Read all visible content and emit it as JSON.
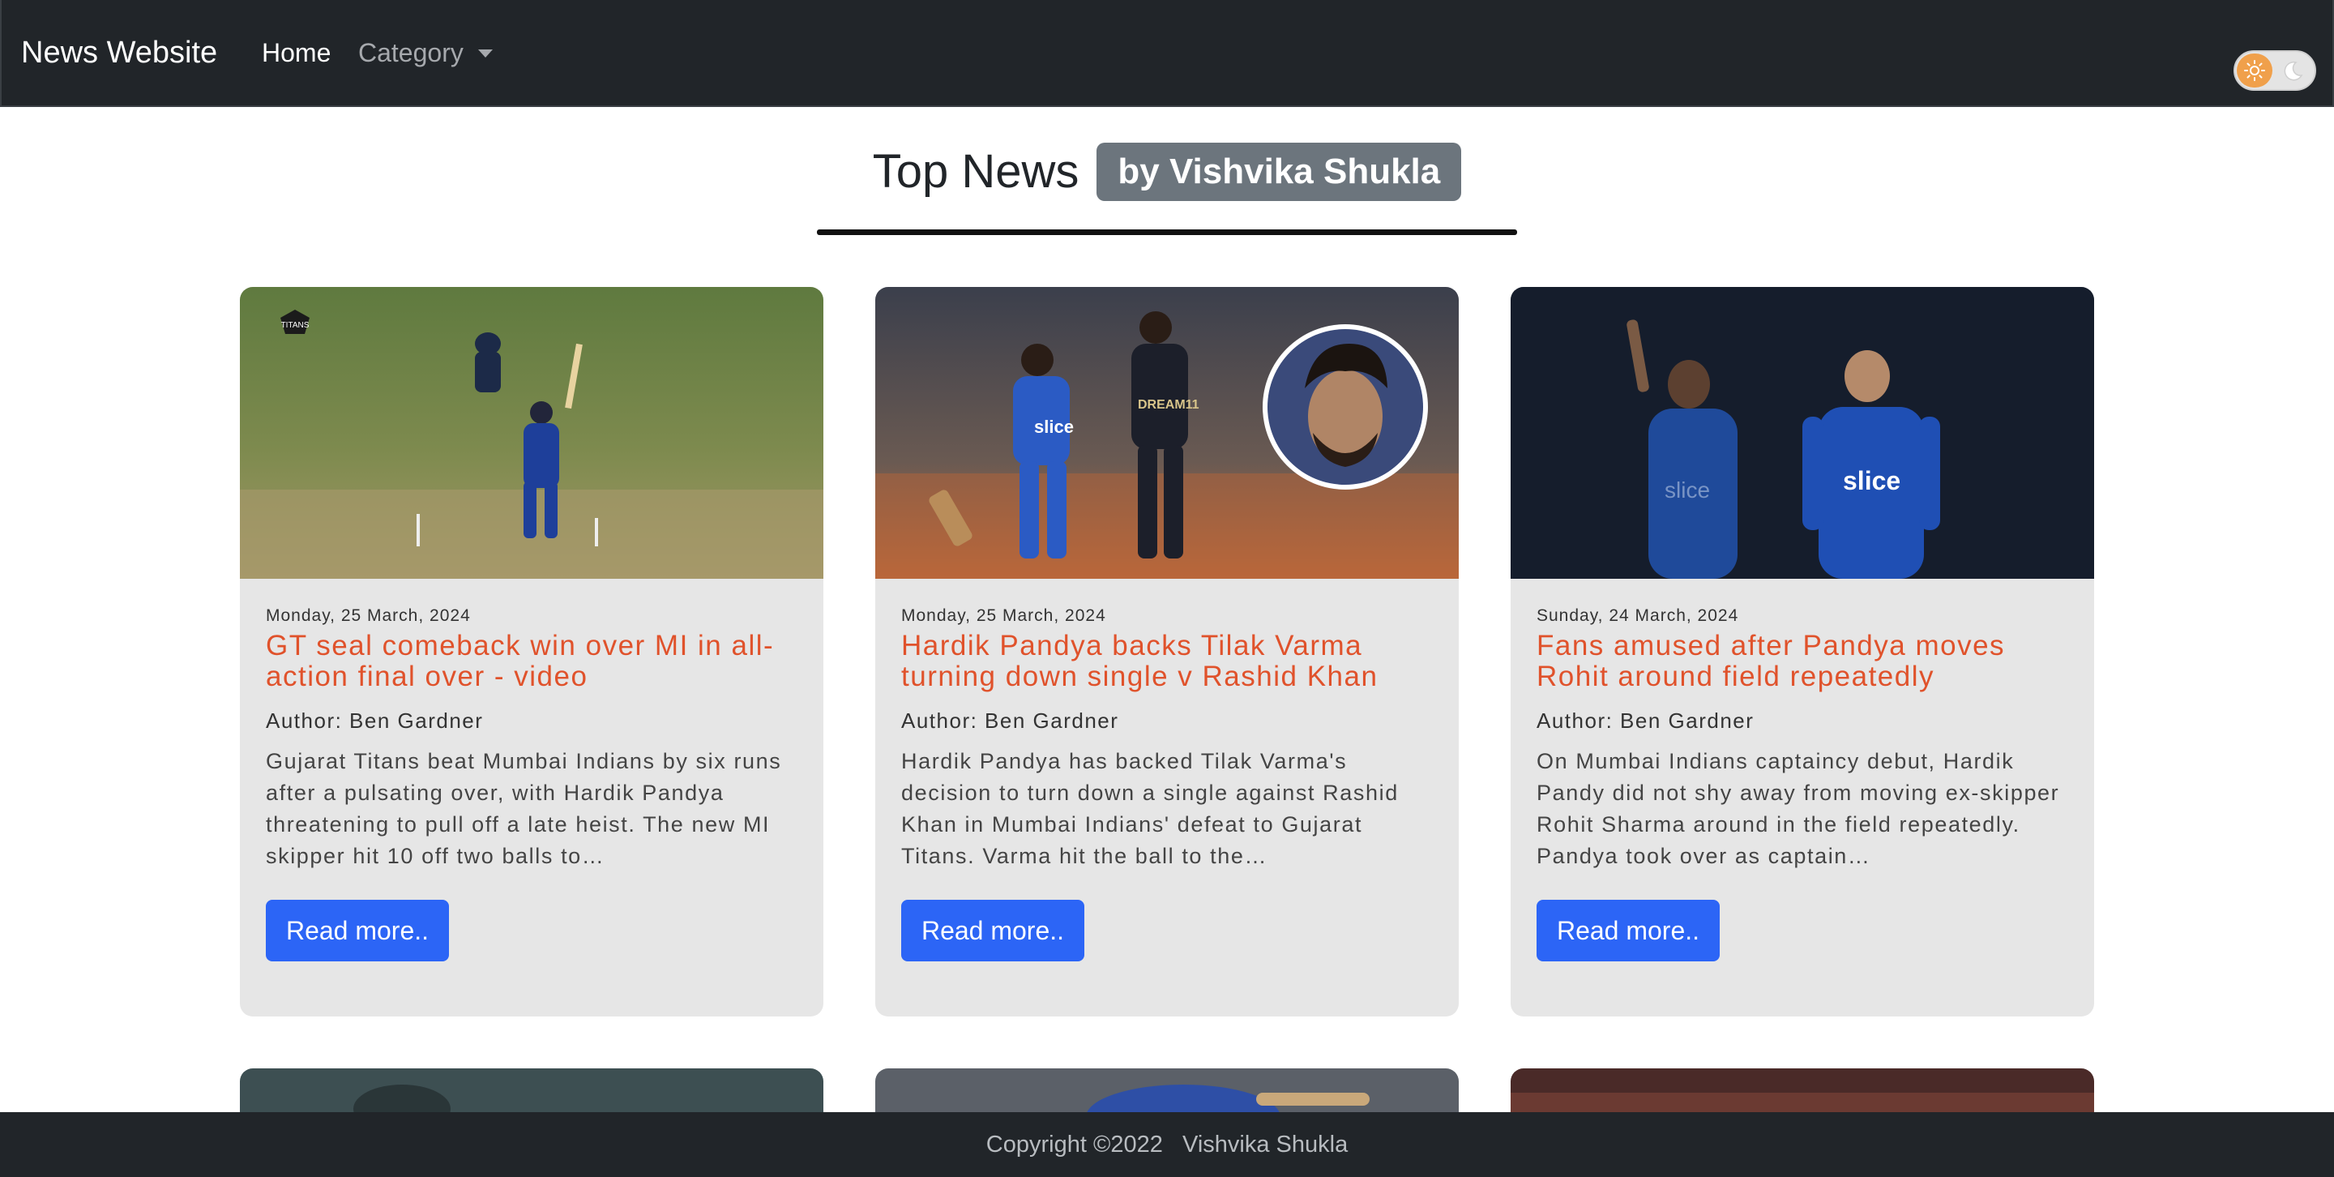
{
  "navbar": {
    "brand": "News Website",
    "home": "Home",
    "category": "Category",
    "theme_toggle": {
      "state": "light",
      "sun_icon": "sun-icon",
      "moon_icon": "moon-icon"
    }
  },
  "heading": {
    "title": "Top News",
    "badge": "by Vishvika Shukla"
  },
  "cards": [
    {
      "date": "Monday, 25 March, 2024",
      "title": "GT seal comeback win over MI in all-action final over - video",
      "author": "Author: Ben Gardner",
      "description": "Gujarat Titans beat Mumbai Indians by six runs after a pulsating over, with Hardik Pandya threatening to pull off a late heist. The new MI skipper hit 10 off two balls to…",
      "button": "Read more.."
    },
    {
      "date": "Monday, 25 March, 2024",
      "title": "Hardik Pandya backs Tilak Varma turning down single v Rashid Khan",
      "author": "Author: Ben Gardner",
      "description": "Hardik Pandya has backed Tilak Varma's decision to turn down a single against Rashid Khan in Mumbai Indians' defeat to Gujarat Titans. Varma hit the ball to the…",
      "button": "Read more.."
    },
    {
      "date": "Sunday, 24 March, 2024",
      "title": "Fans amused after Pandya moves Rohit around field repeatedly",
      "author": "Author: Ben Gardner",
      "description": "On Mumbai Indians captaincy debut, Hardik Pandy did not shy away from moving ex-skipper Rohit Sharma around in the field repeatedly. Pandya took over as captain…",
      "button": "Read more.."
    }
  ],
  "footer": {
    "text": "Copyright ©2022   Vishvika Shukla"
  },
  "colors": {
    "navbar_bg": "#212529",
    "title_accent": "#e0522b",
    "button_bg": "#2c65f6",
    "badge_bg": "#6c757d",
    "card_bg": "#e6e6e6"
  }
}
